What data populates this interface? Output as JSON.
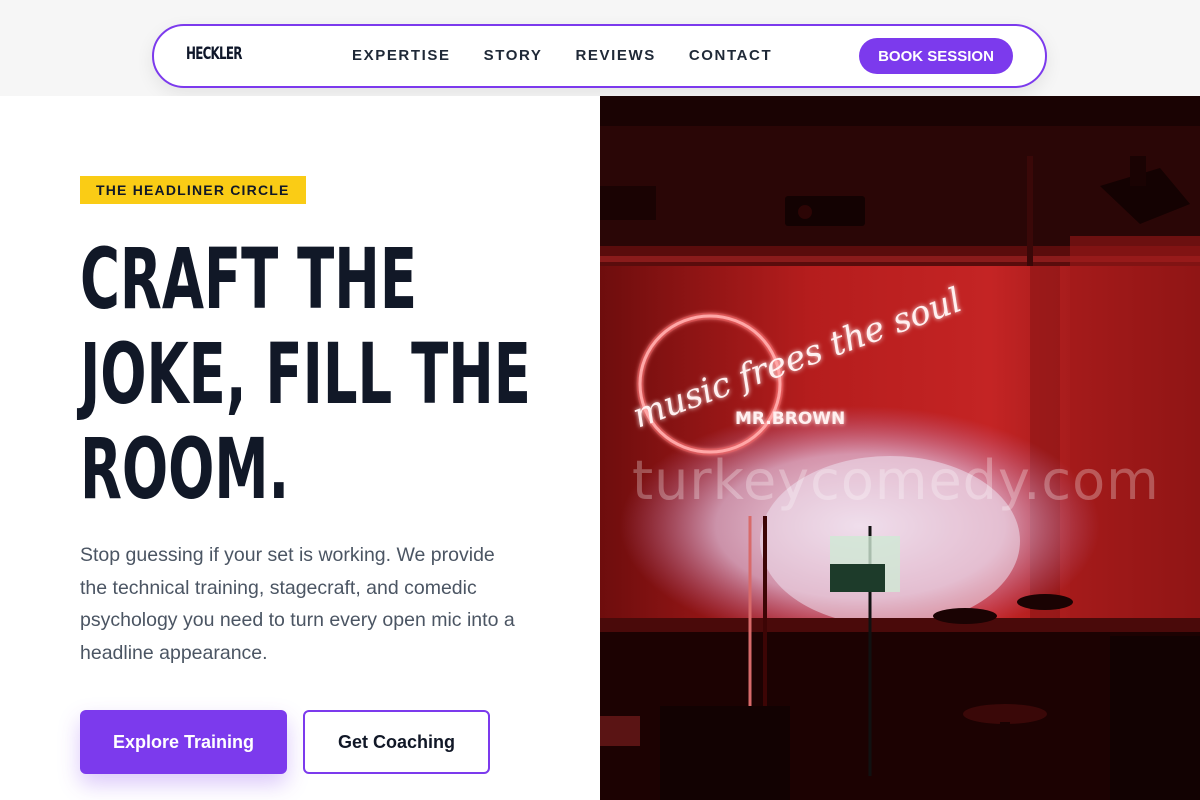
{
  "nav": {
    "logo": "HECKLER",
    "links": [
      "EXPERTISE",
      "STORY",
      "REVIEWS",
      "CONTACT"
    ],
    "cta": "BOOK SESSION"
  },
  "hero": {
    "badge": "THE HEADLINER CIRCLE",
    "headline_lines": [
      "CRAFT THE",
      "JOKE, FILL THE",
      "ROOM."
    ],
    "subtext": "Stop guessing if your set is working. We provide the technical training, stagecraft, and comedic psychology you need to turn every open mic into a headline appearance.",
    "primary_button": "Explore Training",
    "secondary_button": "Get Coaching"
  },
  "image": {
    "neon_line1": "music frees the soul",
    "neon_line2": "MR.BROWN",
    "watermark": "turkeycomedy.com",
    "accent_color": "#7c3aed",
    "badge_color": "#facc15"
  }
}
